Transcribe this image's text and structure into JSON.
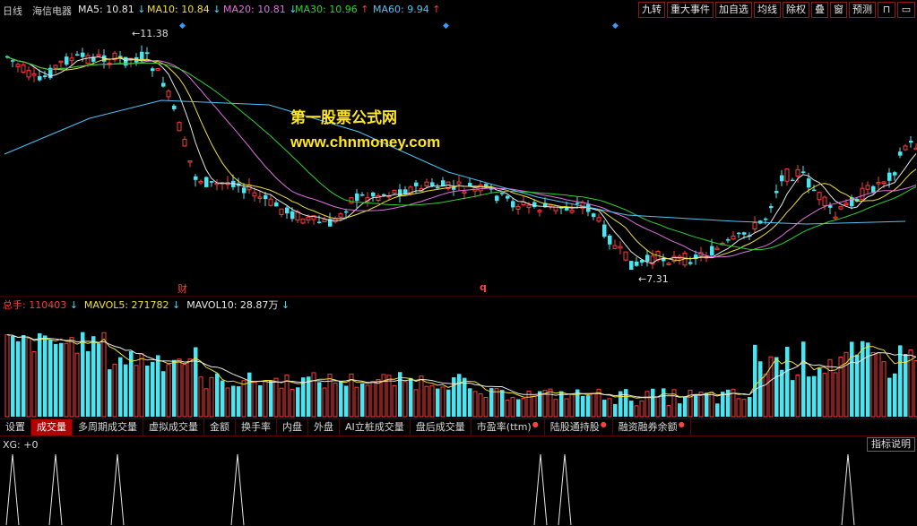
{
  "header": {
    "period": "日线",
    "stock": "海信电器",
    "ma": [
      {
        "label": "MA5: 10.81",
        "arrow": "↓",
        "dir": "down",
        "color": "#e8e8e8"
      },
      {
        "label": "MA10: 10.84",
        "arrow": "↓",
        "dir": "down",
        "color": "#f0e030"
      },
      {
        "label": "MA20: 10.81",
        "arrow": "↓",
        "dir": "down",
        "color": "#e070e0"
      },
      {
        "label": "MA30: 10.96",
        "arrow": "↑",
        "dir": "up",
        "color": "#30d030"
      },
      {
        "label": "MA60: 9.94",
        "arrow": "↑",
        "dir": "up",
        "color": "#4fc3f7"
      }
    ]
  },
  "toolbar": {
    "buttons": [
      "九转",
      "重大事件",
      "加自选",
      "均线",
      "除权",
      "叠",
      "窗",
      "预测"
    ],
    "lock_icon": "lock-icon",
    "fullscreen_icon": "fullscreen-icon"
  },
  "price_chart": {
    "high_label": "11.38",
    "low_label": "7.31",
    "marker_cai": "财",
    "marker_q": "q"
  },
  "watermark": {
    "line1": "第一股票公式网",
    "line2": "www.chnmoney.com"
  },
  "volume": {
    "label_total": "总手: 110403",
    "arrow_total": "↓",
    "label_mavol5": "MAVOL5: 271782",
    "arrow_mavol5": "↓",
    "label_mavol10": "MAVOL10: 28.87万",
    "arrow_mavol10": "↓"
  },
  "tabs": [
    {
      "label": "设置",
      "active": false,
      "dot": false
    },
    {
      "label": "成交量",
      "active": true,
      "dot": false
    },
    {
      "label": "多周期成交量",
      "active": false,
      "dot": false
    },
    {
      "label": "虚拟成交量",
      "active": false,
      "dot": false
    },
    {
      "label": "金额",
      "active": false,
      "dot": false
    },
    {
      "label": "换手率",
      "active": false,
      "dot": false
    },
    {
      "label": "内盘",
      "active": false,
      "dot": false
    },
    {
      "label": "外盘",
      "active": false,
      "dot": false
    },
    {
      "label": "AI立桩成交量",
      "active": false,
      "dot": false
    },
    {
      "label": "盘后成交量",
      "active": false,
      "dot": false
    },
    {
      "label": "市盈率(ttm)",
      "active": false,
      "dot": true
    },
    {
      "label": "陆股通持股",
      "active": false,
      "dot": true
    },
    {
      "label": "融资融券余额",
      "active": false,
      "dot": true
    }
  ],
  "xg": {
    "label": "XG: +0",
    "help": "指标说明"
  },
  "colors": {
    "up": "#ff3b3b",
    "down": "#4fe3f0",
    "ma5": "#e8e8e8",
    "ma10": "#f0e030",
    "ma20": "#e070e0",
    "ma30": "#30d030",
    "ma60": "#4fc3f7"
  }
}
